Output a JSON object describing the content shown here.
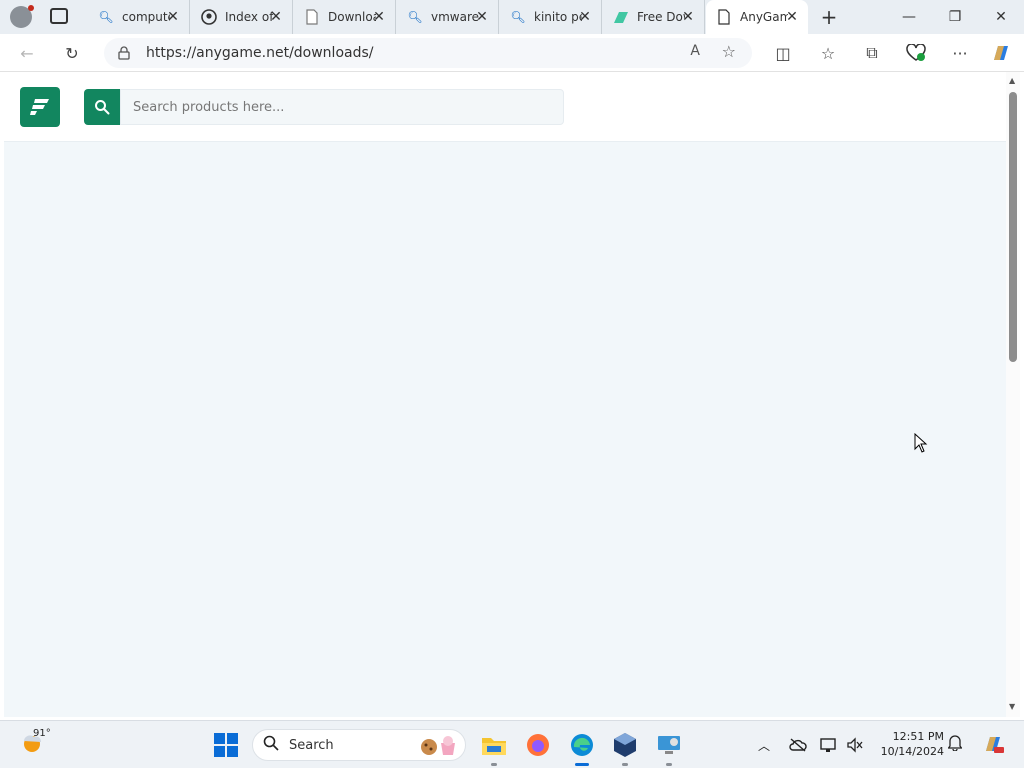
{
  "tabs": [
    {
      "title": "computer",
      "icon": "search-icon"
    },
    {
      "title": "Index of",
      "icon": "github-icon"
    },
    {
      "title": "Downloads",
      "icon": "document-icon"
    },
    {
      "title": "vmware",
      "icon": "search-icon"
    },
    {
      "title": "kinito pet",
      "icon": "search-icon"
    },
    {
      "title": "Free Download",
      "icon": "leaf-icon"
    },
    {
      "title": "AnyGame",
      "icon": "page-icon",
      "active": true
    }
  ],
  "close_glyph": "✕",
  "newtab_glyph": "+",
  "window": {
    "minimize": "—",
    "restore": "❐",
    "close": "✕"
  },
  "toolbar": {
    "back": "←",
    "refresh": "↻",
    "url": "https://anygame.net/downloads/",
    "read_aloud": "A",
    "favorite": "☆",
    "split": "◫",
    "favorites": "☆",
    "collections": "⧉",
    "more": "···"
  },
  "site": {
    "search_placeholder": "Search products here...",
    "brand_color": "#12865f"
  },
  "taskbar": {
    "weather_temp": "91°",
    "search_label": "Search",
    "time": "12:51 PM",
    "date": "10/14/2024"
  }
}
